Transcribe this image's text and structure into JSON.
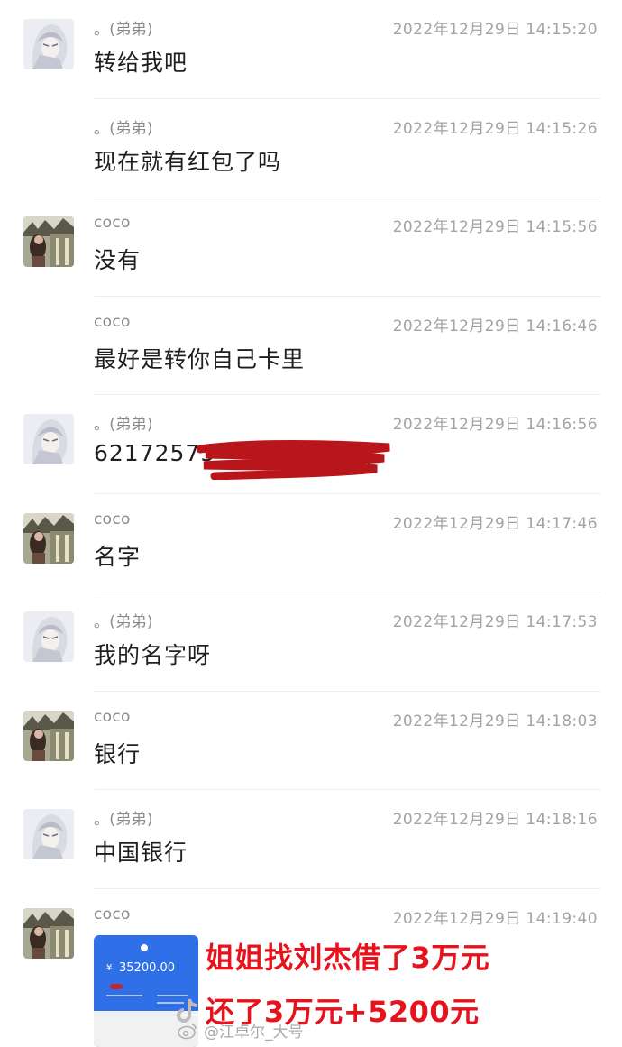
{
  "messages": [
    {
      "sender": "。(弟弟)",
      "time": "2022年12月29日 14:15:20",
      "text": "转给我吧",
      "avatar": "anime-avatar",
      "show_avatar": true
    },
    {
      "sender": "。(弟弟)",
      "time": "2022年12月29日 14:15:26",
      "text": "现在就有红包了吗",
      "avatar": "anime-avatar",
      "show_avatar": false
    },
    {
      "sender": "coco",
      "time": "2022年12月29日 14:15:56",
      "text": "没有",
      "avatar": "photo-avatar",
      "show_avatar": true
    },
    {
      "sender": "coco",
      "time": "2022年12月29日 14:16:46",
      "text": "最好是转你自己卡里",
      "avatar": "photo-avatar",
      "show_avatar": false
    },
    {
      "sender": "。(弟弟)",
      "time": "2022年12月29日 14:16:56",
      "text": "62172575",
      "avatar": "anime-avatar",
      "show_avatar": true
    },
    {
      "sender": "coco",
      "time": "2022年12月29日 14:17:46",
      "text": "名字",
      "avatar": "photo-avatar",
      "show_avatar": true
    },
    {
      "sender": "。(弟弟)",
      "time": "2022年12月29日 14:17:53",
      "text": "我的名字呀",
      "avatar": "anime-avatar",
      "show_avatar": true
    },
    {
      "sender": "coco",
      "time": "2022年12月29日 14:18:03",
      "text": "银行",
      "avatar": "photo-avatar",
      "show_avatar": true
    },
    {
      "sender": "。(弟弟)",
      "time": "2022年12月29日 14:18:16",
      "text": "中国银行",
      "avatar": "anime-avatar",
      "show_avatar": true
    },
    {
      "sender": "coco",
      "time": "2022年12月29日 14:19:40",
      "text": "",
      "avatar": "photo-avatar",
      "show_avatar": true
    }
  ],
  "payment_card": {
    "currency": "¥",
    "amount": "35200.00"
  },
  "overlay_caption": {
    "line1": "姐姐找刘杰借了3万元",
    "line2": "还了3万元+5200元"
  },
  "watermark": {
    "text": "@江卓尔_大号",
    "icon": "weibo-icon"
  },
  "colors": {
    "overlay_red": "#e8121c",
    "scribble_red": "#b8161a",
    "card_blue": "#2f6fe7"
  }
}
